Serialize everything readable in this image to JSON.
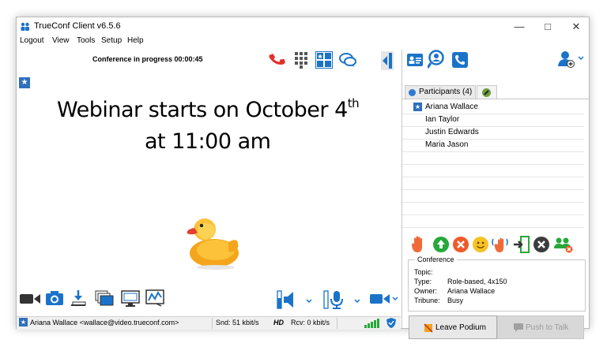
{
  "window": {
    "title": "TrueConf Client v6.5.6"
  },
  "menu": {
    "items": [
      "Logout",
      "View",
      "Tools",
      "Setup",
      "Help"
    ]
  },
  "toolbar": {
    "status": "Conference in progress 00:00:45"
  },
  "slide": {
    "line1": "Webinar starts on October 4",
    "line1_sup": "th",
    "line2": "at 11:00 am"
  },
  "participants": {
    "tab_label": "Participants (4)",
    "list": [
      "Ariana Wallace",
      "Ian Taylor",
      "Justin Edwards",
      "Maria Jason"
    ]
  },
  "conference": {
    "title": "Conference",
    "topic_label": "Topic:",
    "topic_value": "",
    "type_label": "Type:",
    "type_value": "Role-based, 4x150",
    "owner_label": "Owner:",
    "owner_value": "Ariana Wallace",
    "tribune_label": "Tribune:",
    "tribune_value": "Busy"
  },
  "buttons": {
    "leave_podium": "Leave Podium",
    "push_to_talk": "Push to Talk"
  },
  "status": {
    "user": "Ariana Wallace <wallace@video.trueconf.com>",
    "snd": "Snd: 51 kbit/s",
    "hd": "HD",
    "rcv": "Rcv: 0 kbit/s"
  },
  "colors": {
    "accent": "#1b73c9",
    "hangup": "#e2312b",
    "green": "#27a83a",
    "star": "#2f6fbd"
  },
  "icons": {
    "toolbar": [
      "hangup-icon",
      "keypad-icon",
      "layout-icon",
      "chat-icon",
      "panel-toggle-icon",
      "contacts-icon",
      "search-user-icon",
      "calls-icon",
      "add-user-icon"
    ],
    "bottom": [
      "camera-icon",
      "photo-icon",
      "file-transfer-icon",
      "slideshow-icon",
      "screen-share-icon",
      "whiteboard-icon",
      "speaker-icon",
      "microphone-icon",
      "video-settings-icon"
    ],
    "actions": [
      "raise-hand-icon",
      "promote-icon",
      "remove-icon",
      "smile-icon",
      "wave-icon",
      "exit-podium-icon",
      "close-icon",
      "group-icon"
    ]
  }
}
